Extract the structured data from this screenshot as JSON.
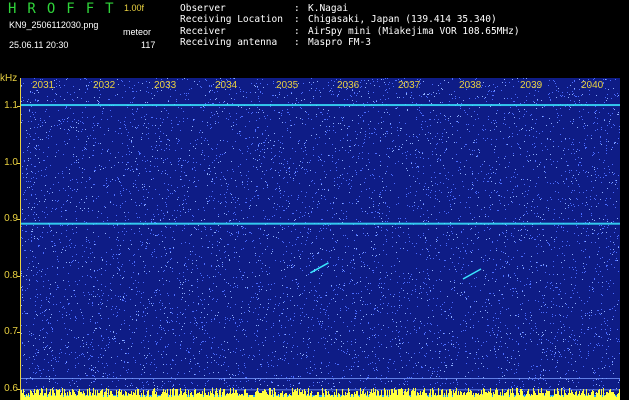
{
  "app": {
    "logo": "HROFFT",
    "version": "1.00f",
    "filename": "KN9_2506112030.png",
    "mode": "meteor",
    "datetime": "25.06.11 20:30",
    "count": "117"
  },
  "info": [
    {
      "label": "Observer",
      "value": "K.Nagai"
    },
    {
      "label": "Receiving Location",
      "value": "Chigasaki, Japan (139.414 35.340)"
    },
    {
      "label": "Receiver",
      "value": "AirSpy mini (Miakejima VOR 108.65MHz)"
    },
    {
      "label": "Receiving antenna",
      "value": "Maspro FM-3"
    }
  ],
  "chart_data": {
    "type": "heatmap",
    "ylabel": "kHz",
    "y_ticks": [
      "1.1",
      "1.0",
      "0.9",
      "0.8",
      "0.7",
      "0.6"
    ],
    "x_ticks": [
      "2031",
      "2032",
      "2033",
      "2034",
      "2035",
      "2036",
      "2037",
      "2038",
      "2039",
      "2040"
    ],
    "ylim": [
      0.58,
      1.15
    ],
    "colors": {
      "background": "#0e1c86",
      "noise": "#4a6cff",
      "signal": "#39e6ff",
      "hot": "#ffff40",
      "axis": "#e8d040"
    },
    "carriers_khz": [
      1.103,
      0.893,
      0.618,
      0.598
    ],
    "meteor_echoes": [
      {
        "time": "2035.5",
        "freq_khz": 0.814
      },
      {
        "time": "2038.0",
        "freq_khz": 0.803
      }
    ]
  }
}
